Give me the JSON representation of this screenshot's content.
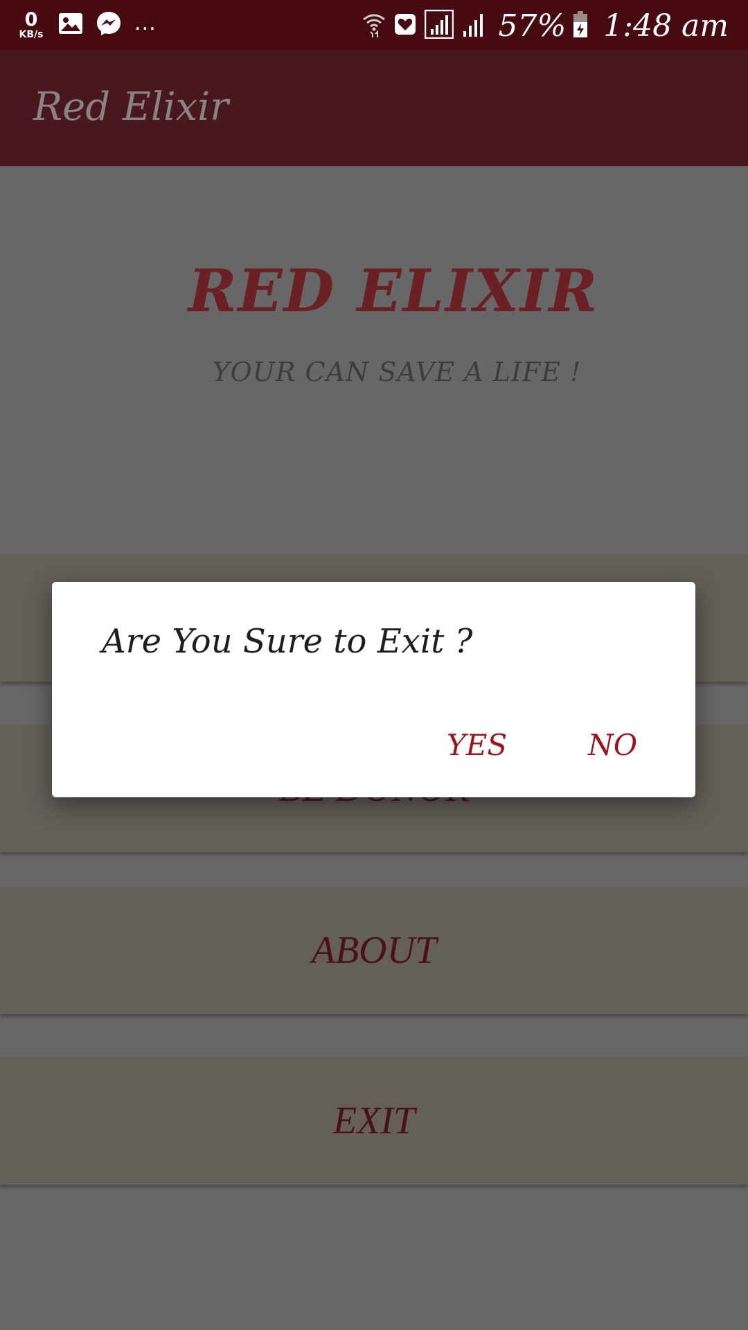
{
  "status_bar": {
    "speed_value": "0",
    "speed_unit": "KB/s",
    "overflow": "...",
    "battery_percent": "57%",
    "time": "1:48 am",
    "icons": [
      "gallery-icon",
      "messenger-icon",
      "wifi-icon",
      "health-icon",
      "signal-icon",
      "signal-icon",
      "battery-icon"
    ]
  },
  "toolbar": {
    "title": "Red Elixir"
  },
  "hero": {
    "title": "RED ELIXIR",
    "tagline": "YOUR  CAN SAVE A LIFE !"
  },
  "menu": {
    "items": [
      {
        "label": ""
      },
      {
        "label": "BE DONOR"
      },
      {
        "label": "ABOUT"
      },
      {
        "label": "EXIT"
      }
    ]
  },
  "dialog": {
    "message": "Are You Sure to Exit ?",
    "yes_label": "YES",
    "no_label": "NO"
  },
  "colors": {
    "status_bar": "#470a10",
    "toolbar": "#48181e",
    "accent": "#9b141c",
    "scrim_background": "#676767"
  }
}
